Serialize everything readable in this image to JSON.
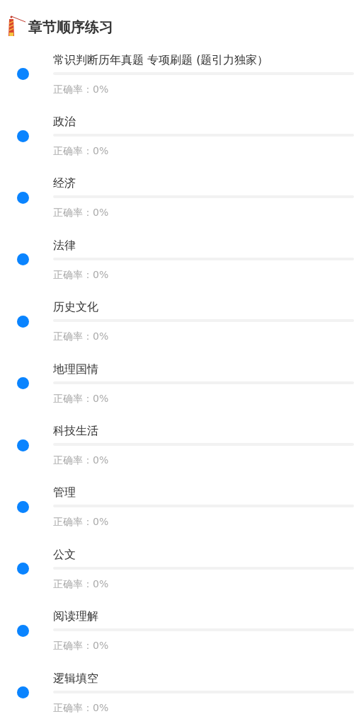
{
  "header": {
    "title": "章节顺序练习"
  },
  "chapters": [
    {
      "title": "常识判断历年真题 专项刷题 (题引力独家）",
      "level": 0,
      "accuracy": "正确率：0%"
    },
    {
      "title": "政治",
      "level": 0,
      "accuracy": "正确率：0%"
    },
    {
      "title": "经济",
      "level": 0,
      "accuracy": "正确率：0%"
    },
    {
      "title": "法律",
      "level": 0,
      "accuracy": "正确率：0%"
    },
    {
      "title": "历史文化",
      "level": 0,
      "accuracy": "正确率：0%"
    },
    {
      "title": "地理国情",
      "level": 0,
      "accuracy": "正确率：0%"
    },
    {
      "title": "科技生活",
      "level": 0,
      "accuracy": "正确率：0%"
    },
    {
      "title": "管理",
      "level": 0,
      "accuracy": "正确率：0%"
    },
    {
      "title": "公文",
      "level": 0,
      "accuracy": "正确率：0%"
    },
    {
      "title": "阅读理解",
      "level": 0,
      "accuracy": "正确率：0%"
    },
    {
      "title": "逻辑填空",
      "level": 0,
      "accuracy": "正确率：0%"
    }
  ]
}
